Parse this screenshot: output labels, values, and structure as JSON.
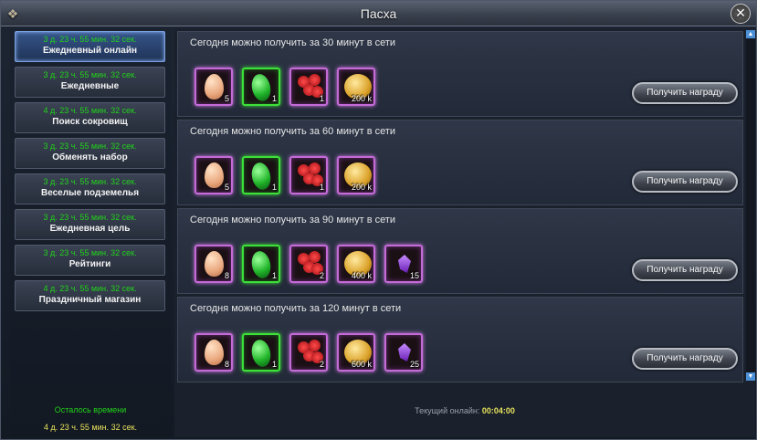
{
  "window": {
    "title": "Пасха"
  },
  "sidebar": {
    "items": [
      {
        "timer": "3 д. 23 ч. 55 мин. 32 сек.",
        "label": "Ежедневный онлайн",
        "active": true
      },
      {
        "timer": "3 д. 23 ч. 55 мин. 32 сек.",
        "label": "Ежедневные"
      },
      {
        "timer": "4 д. 23 ч. 55 мин. 32 сек.",
        "label": "Поиск сокровищ"
      },
      {
        "timer": "3 д. 23 ч. 55 мин. 32 сек.",
        "label": "Обменять набор"
      },
      {
        "timer": "3 д. 23 ч. 55 мин. 32 сек.",
        "label": "Веселые подземелья"
      },
      {
        "timer": "3 д. 23 ч. 55 мин. 32 сек.",
        "label": "Ежедневная цель"
      },
      {
        "timer": "3 д. 23 ч. 55 мин. 32 сек.",
        "label": "Рейтинги"
      },
      {
        "timer": "4 д. 23 ч. 55 мин. 32 сек.",
        "label": "Праздничный магазин"
      }
    ],
    "remaining_title": "Осталось времени",
    "remaining_time": "4 д. 23 ч. 55 мин. 32 сек."
  },
  "rewards": {
    "claim_label": "Получить награду",
    "rows": [
      {
        "title": "Сегодня можно получить за 30 минут в сети",
        "items": [
          {
            "icon": "egg-icon",
            "count": "5"
          },
          {
            "icon": "emerald-icon",
            "count": "1"
          },
          {
            "icon": "roses-icon",
            "count": "1"
          },
          {
            "icon": "gold-coins-icon",
            "count": "200 k"
          }
        ]
      },
      {
        "title": "Сегодня можно получить за 60 минут в сети",
        "items": [
          {
            "icon": "egg-icon",
            "count": "5"
          },
          {
            "icon": "emerald-icon",
            "count": "1"
          },
          {
            "icon": "roses-icon",
            "count": "1"
          },
          {
            "icon": "gold-coins-icon",
            "count": "200 k"
          }
        ]
      },
      {
        "title": "Сегодня можно получить за 90 минут в сети",
        "items": [
          {
            "icon": "egg-icon",
            "count": "8"
          },
          {
            "icon": "emerald-icon",
            "count": "1"
          },
          {
            "icon": "roses-icon",
            "count": "2"
          },
          {
            "icon": "gold-coins-icon",
            "count": "400 k"
          },
          {
            "icon": "crystal-icon",
            "count": "15"
          }
        ]
      },
      {
        "title": "Сегодня можно получить за 120 минут в сети",
        "items": [
          {
            "icon": "egg-icon",
            "count": "8"
          },
          {
            "icon": "emerald-icon",
            "count": "1"
          },
          {
            "icon": "roses-icon",
            "count": "2"
          },
          {
            "icon": "gold-coins-icon",
            "count": "600 k"
          },
          {
            "icon": "crystal-icon",
            "count": "25"
          }
        ]
      }
    ]
  },
  "footer": {
    "online_label": "Текущий онлайн:",
    "online_value": "00:04:00"
  },
  "colors": {
    "timer_green": "#21d21a",
    "highlight_yellow": "#e7e15c",
    "purple_frame": "#c46bd8",
    "green_frame": "#3ee03a",
    "active_tab": "#36558a"
  }
}
